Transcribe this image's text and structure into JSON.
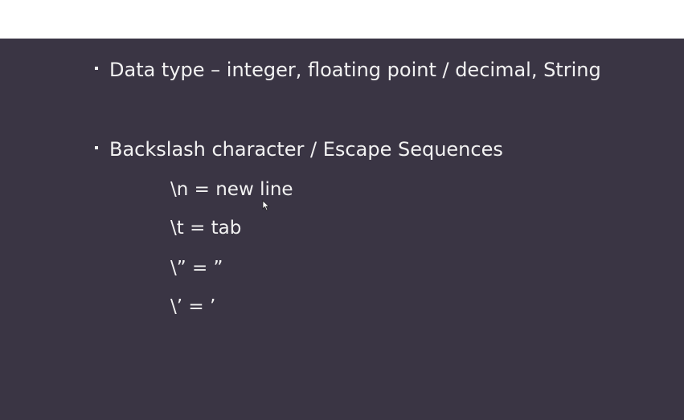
{
  "slide": {
    "bullets": [
      "Data type – integer, floating point / decimal, String",
      "Backslash character / Escape Sequences"
    ],
    "escape_sequences": [
      "\\n = new line",
      "\\t = tab",
      "\\” =  ”",
      "\\’ =  ’"
    ]
  },
  "colors": {
    "background": "#3a3544",
    "text": "#f2f2f2"
  },
  "icons": {
    "cursor": "mouse-pointer-icon"
  }
}
